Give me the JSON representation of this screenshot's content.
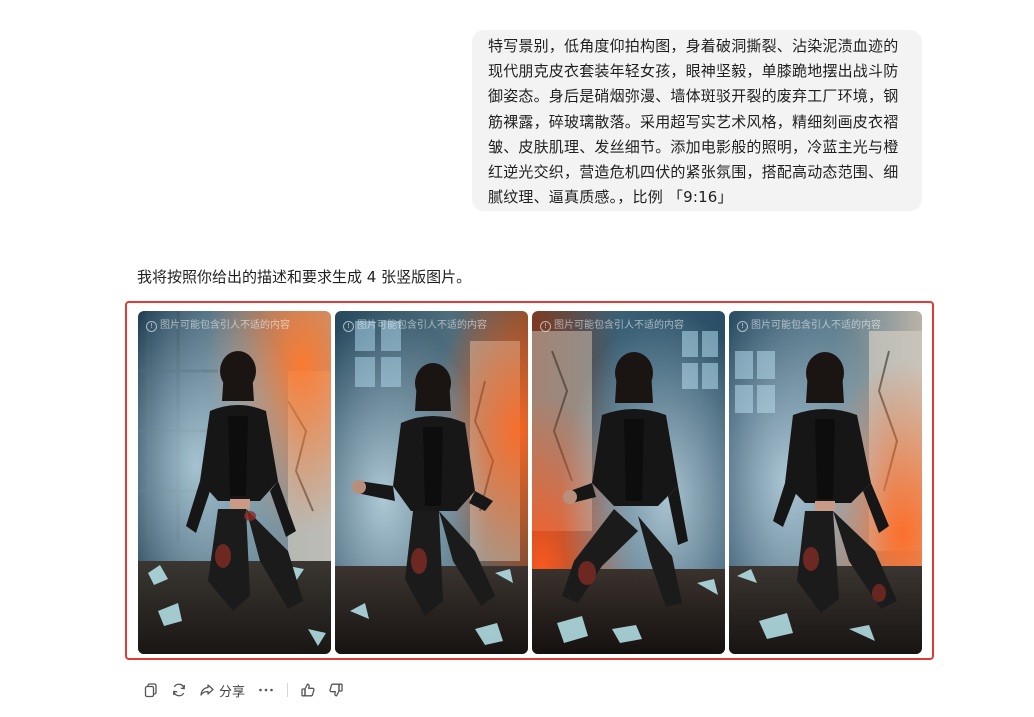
{
  "user_message": {
    "text": "特写景别，低角度仰拍构图，身着破洞撕裂、沾染泥渍血迹的现代朋克皮衣套装年轻女孩，眼神坚毅，单膝跪地摆出战斗防御姿态。身后是硝烟弥漫、墙体斑驳开裂的废弃工厂环境，钢筋裸露，碎玻璃散落。采用超写实艺术风格，精细刻画皮衣褶皱、皮肤肌理、发丝细节。添加电影般的照明，冷蓝主光与橙红逆光交织，营造危机四伏的紧张氛围，搭配高动态范围、细腻纹理、逼真质感。，比例 「9:16」"
  },
  "assistant": {
    "intro": "我将按照你给出的描述和要求生成 4 张竖版图片。",
    "images": [
      {
        "watermark": "图片可能包含引人不适的内容",
        "glow": "left"
      },
      {
        "watermark": "图片可能包含引人不适的内容",
        "glow": "right"
      },
      {
        "watermark": "图片可能包含引人不适的内容",
        "glow": "left"
      },
      {
        "watermark": "图片可能包含引人不适的内容",
        "glow": "right"
      }
    ]
  },
  "toolbar": {
    "share_label": "分享",
    "icons": [
      "copy-icon",
      "regenerate-icon",
      "share-icon",
      "more-icon",
      "thumbs-up-icon",
      "thumbs-down-icon"
    ]
  },
  "colors": {
    "highlight": "#e53935",
    "bubble_bg": "#f3f3f3",
    "cool_light": "#4d8fb5",
    "warm_light": "#ff5a1f"
  }
}
